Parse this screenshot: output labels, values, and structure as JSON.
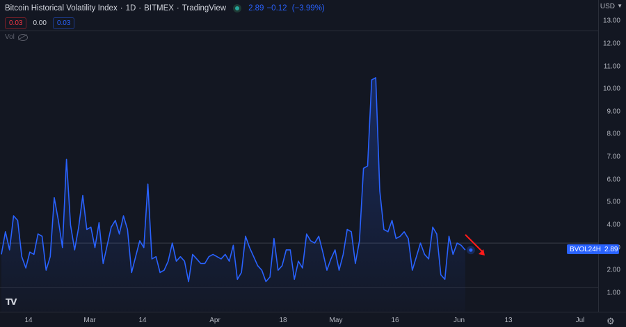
{
  "header": {
    "title": "Bitcoin Historical Volatility Index",
    "interval": "1D",
    "exchange": "BITMEX",
    "source": "TradingView",
    "last_price": "2.89",
    "change": "−0.12",
    "change_pct": "(−3.99%)"
  },
  "indicator_values": {
    "left": "0.03",
    "middle": "0.00",
    "right": "0.03"
  },
  "volume_label": "Vol",
  "currency": "USD",
  "currency_caret": "▼",
  "price_tag": {
    "name": "BVOL24H",
    "value": "2.89"
  },
  "colors": {
    "background": "#131722",
    "line": "#2962ff",
    "accent_red": "#f23645",
    "annotation_arrow": "#ff1a1a"
  },
  "icons": {
    "logo": "tradingview-logo",
    "settings": "gear-icon",
    "status": "status-dot-icon"
  },
  "chart_data": {
    "type": "line",
    "series": [
      {
        "name": "BVOL24H",
        "values": [
          2.7,
          3.7,
          2.9,
          4.4,
          4.2,
          2.6,
          2.1,
          2.8,
          2.7,
          3.6,
          3.5,
          2.0,
          2.6,
          5.2,
          4.2,
          3.0,
          6.9,
          4.0,
          2.9,
          3.9,
          5.3,
          3.8,
          3.9,
          3.0,
          4.1,
          2.3,
          3.1,
          3.9,
          4.2,
          3.6,
          4.4,
          3.8,
          1.9,
          2.6,
          3.3,
          3.0,
          5.8,
          2.5,
          2.6,
          1.9,
          2.0,
          2.4,
          3.2,
          2.4,
          2.6,
          2.4,
          1.5,
          2.7,
          2.5,
          2.3,
          2.3,
          2.6,
          2.7,
          2.6,
          2.5,
          2.7,
          2.4,
          3.1,
          1.6,
          1.9,
          3.5,
          3.0,
          2.6,
          2.2,
          2.0,
          1.5,
          1.7,
          3.4,
          2.0,
          2.2,
          2.9,
          2.9,
          1.6,
          2.4,
          2.1,
          3.6,
          3.3,
          3.2,
          3.5,
          2.8,
          2.0,
          2.5,
          2.9,
          2.0,
          2.7,
          3.8,
          3.7,
          2.3,
          3.3,
          6.5,
          6.6,
          10.4,
          10.5,
          5.5,
          3.8,
          3.7,
          4.2,
          3.4,
          3.5,
          3.7,
          3.4,
          2.0,
          2.6,
          3.2,
          2.7,
          2.5,
          3.9,
          3.6,
          1.8,
          1.6,
          3.5,
          2.7,
          3.2,
          3.1,
          2.89
        ]
      }
    ],
    "ylim": [
      0.5,
      13.5
    ],
    "y_ticks": [
      "13.00",
      "12.00",
      "11.00",
      "10.00",
      "9.00",
      "8.00",
      "7.00",
      "6.00",
      "5.00",
      "4.00",
      "3.00",
      "2.00",
      "1.00"
    ],
    "x_ticks": [
      "14",
      "Mar",
      "14",
      "Apr",
      "18",
      "May",
      "16",
      "Jun",
      "13",
      "Jul"
    ],
    "grid": false,
    "area_fill": true
  }
}
